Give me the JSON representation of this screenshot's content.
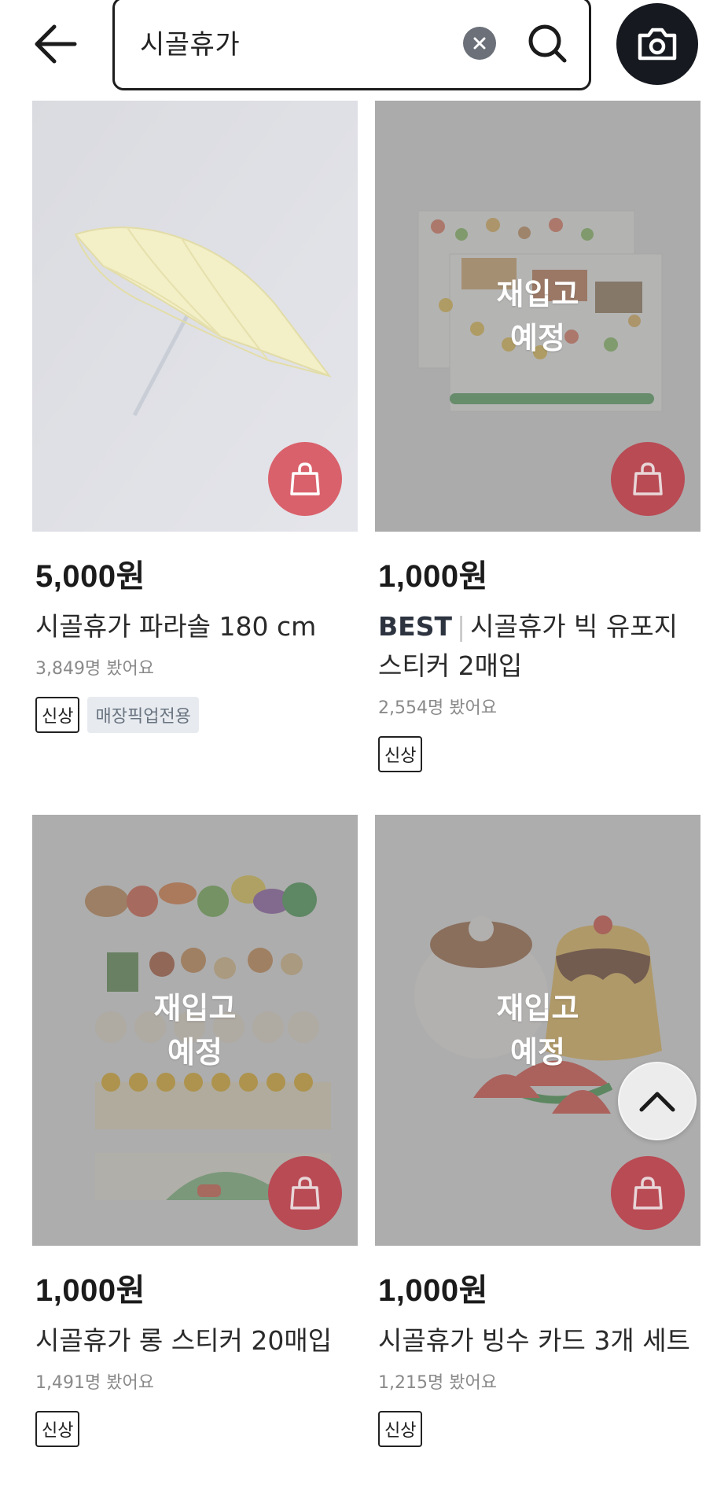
{
  "header": {
    "search_query": "시골휴가"
  },
  "icons": {
    "back": "arrow-left-icon",
    "clear": "clear-x-icon",
    "search": "search-icon",
    "camera": "camera-icon",
    "cart": "shopping-bag-icon",
    "scroll_top": "chevron-up-icon"
  },
  "products": [
    {
      "price": "5,000원",
      "title": "시골휴가 파라솔 180 cm",
      "views": "3,849명 봤어요",
      "tag_new": "신상",
      "tag_pickup": "매장픽업전용"
    },
    {
      "price": "1,000원",
      "best": "BEST",
      "title": "시골휴가 빅 유포지 스티커 2매입",
      "views": "2,554명 봤어요",
      "tag_new": "신상",
      "restock_line1": "재입고",
      "restock_line2": "예정"
    },
    {
      "price": "1,000원",
      "title": "시골휴가 롱 스티커 20매입",
      "views": "1,491명 봤어요",
      "tag_new": "신상",
      "restock_line1": "재입고",
      "restock_line2": "예정"
    },
    {
      "price": "1,000원",
      "title": "시골휴가 빙수 카드 3개 세트",
      "views": "1,215명 봤어요",
      "tag_new": "신상",
      "restock_line1": "재입고",
      "restock_line2": "예정"
    }
  ],
  "colors": {
    "cart_button": "#d9616b",
    "camera_button": "#16191f",
    "clear_button": "#6b7079",
    "pickup_tag_bg": "#e7ebf0"
  }
}
